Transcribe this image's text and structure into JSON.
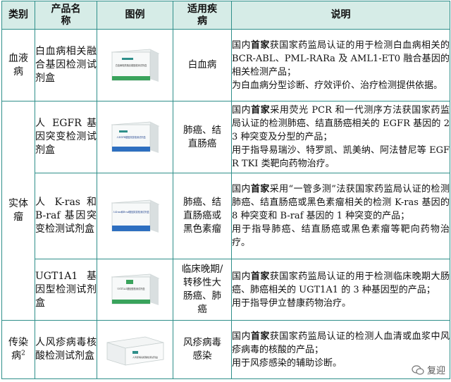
{
  "headers": [
    "类别",
    "产品名称",
    "图例",
    "适用疾病",
    "说明"
  ],
  "rows": [
    {
      "category": "血液病",
      "product": "白血病相关融合基因检测试剂盒",
      "box_label": "白血病相关融合基因检测试剂盒",
      "disease": "白血病",
      "desc_pre": "国内",
      "desc_hl": "首家",
      "desc_main": "获国家药监局认证的用于检测白血病相关的 BCR-ABL、PML-RARa 及 AML1-ET0 融合基因的相关检测产品；",
      "desc_use": "为白血病分型诊断、疗效评价、治疗检测提供依据。"
    },
    {
      "category": "实体瘤",
      "product": "人 EGFR 基因突变检测试剂盒",
      "box_label": "人EGFR基因突变检测试剂盒",
      "disease": "肺癌、结直肠癌",
      "desc_pre": "国内",
      "desc_hl": "首家",
      "desc_main": "采用荧光 PCR 和一代测序方法获国家药监局认证的检测肺癌、结直肠癌相关的 EGFR 基因的 23 种突变及分型的产品；",
      "desc_use": "用于指导易瑞沙、特罗凯、凯美纳、阿法替尼等 EGFR TKI 类靶向药物治疗。"
    },
    {
      "product": "人 K-ras 和 B-raf 基因突变检测试剂盒",
      "box_label": "人K-ras和B-raf基因突变检测试剂盒",
      "disease": "肺癌、结直肠癌或黑色素瘤",
      "desc_pre": "国内",
      "desc_hl": "首家",
      "desc_main": "采用“一管多测”法获国家药监局认证的检测肺癌、结直肠癌或黑色素瘤相关的检测 K-ras 基因的 8 种突变和 B-raf 基因的 1 种突变的产品；",
      "desc_use": "用于指导肺癌、结直肠癌或黑色素瘤等靶向药物治疗。"
    },
    {
      "product": "UGT1A1 基因型检测试剂盒",
      "box_label": "UGT1A1基因型检测试剂盒",
      "disease": "临床晚期/转移性大肠癌、肺癌",
      "desc_pre": "国内",
      "desc_hl": "首家",
      "desc_main": "获国家药监局认证的用于检测临床晚期大肠癌、肺癌相关的 UGT1A1 的 3 种基因型的产品；",
      "desc_use": "用于指导伊立替康药物治疗。"
    },
    {
      "category": "传染病",
      "category_sup": "2",
      "product": "人风疹病毒核酸检测试剂盒",
      "box_label": "人风疹病毒核酸检测试剂盒",
      "disease": "风疹病毒感染",
      "desc_pre": "国内",
      "desc_hl": "首家",
      "desc_main": "获国家药监局认证的检测人血清或血浆中风疹病毒的核酸的产品；",
      "desc_use": "用于风疹感染的辅助诊断。"
    }
  ],
  "watermark": "复迎",
  "colors": {
    "border": "#2f8f8a",
    "header_bg": "#d6ece7",
    "box_green": "#3aa35c",
    "box_blue": "#2e6fc0"
  }
}
